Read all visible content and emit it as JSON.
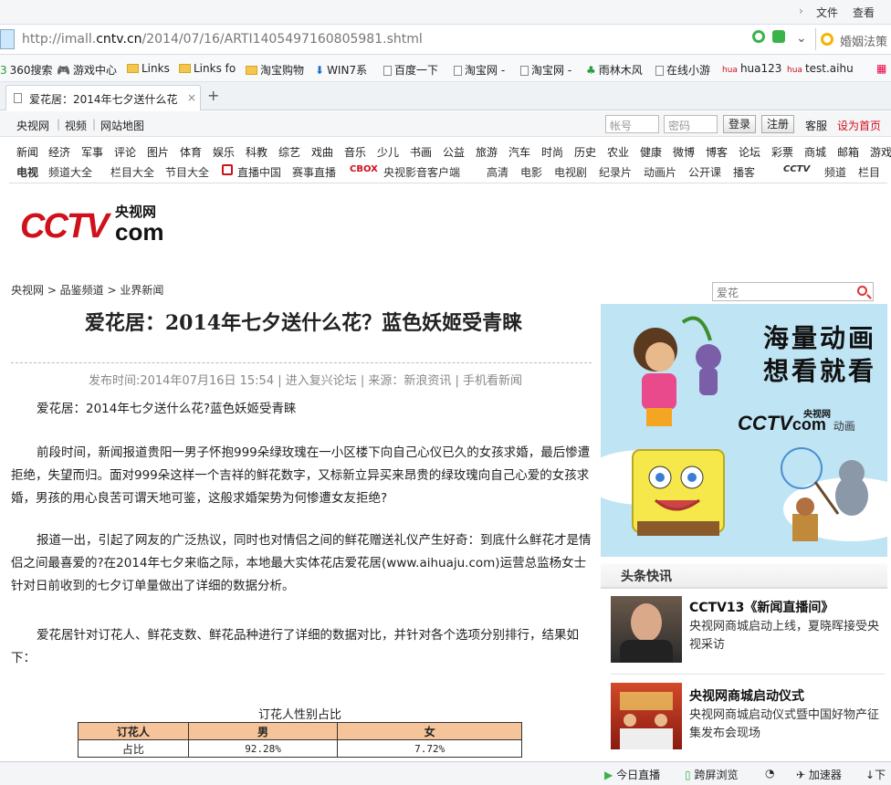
{
  "browser": {
    "menu": {
      "file": "文件",
      "view": "查看"
    },
    "address": {
      "prefix": "http://imall.",
      "domain": "cntv.cn",
      "path": "/2014/07/16/ARTI1405497160805981.shtml"
    },
    "search_hint": "婚姻法策",
    "bookmarks": [
      "360搜索",
      "游戏中心",
      "Links",
      "Links fo",
      "淘宝购物",
      "WIN7系",
      "百度一下",
      "淘宝网 -",
      "淘宝网 -",
      "雨林木风",
      "在线小游",
      "hua123",
      "test.aihu"
    ],
    "tab_title": "爱花居：2014年七夕送什么花",
    "new_tab": "+"
  },
  "site": {
    "top_links": [
      "央视网",
      "视频",
      "网站地图"
    ],
    "username_placeholder": "帐号",
    "password_placeholder": "密码",
    "login": "登录",
    "register": "注册",
    "service": "客服",
    "set_home": "设为首页",
    "nav1": [
      "新闻",
      "经济",
      "军事",
      "评论",
      "图片",
      "体育",
      "娱乐",
      "科教",
      "综艺",
      "戏曲",
      "音乐",
      "少儿",
      "书画",
      "公益",
      "旅游",
      "汽车",
      "时尚",
      "历史",
      "农业",
      "健康",
      "微博",
      "博客",
      "论坛",
      "彩票",
      "商城",
      "邮箱",
      "游戏"
    ],
    "nav2": [
      "电视",
      "频道大全",
      "栏目大全",
      "节目大全",
      "直播中国",
      "赛事直播",
      "央视影音客户端",
      "高清",
      "电影",
      "电视剧",
      "纪录片",
      "动画片",
      "公开课",
      "播客",
      "频道",
      "栏目"
    ],
    "nav2_box": "CBOX",
    "nav2_cctv": "CCTV",
    "logo_text": "CCTV",
    "logo_com": "com",
    "logo_cn": "央视网"
  },
  "article": {
    "breadcrumb": "央视网 > 品鉴频道 > 业界新闻",
    "title": "爱花居：2014年七夕送什么花？蓝色妖姬受青睐",
    "meta": "发布时间:2014年07月16日  15:54 | 进入复兴论坛 | 来源：新浪资讯 | 手机看新闻",
    "paragraphs": [
      "爱花居：2014年七夕送什么花?蓝色妖姬受青睐",
      "前段时间，新闻报道贵阳一男子怀抱999朵绿玫瑰在一小区楼下向自己心仪已久的女孩求婚，最后惨遭拒绝，失望而归。面对999朵这样一个吉祥的鲜花数字，又标新立异买来昂贵的绿玫瑰向自己心爱的女孩求婚，男孩的用心良苦可谓天地可鉴，这般求婚架势为何惨遭女友拒绝?",
      "报道一出，引起了网友的广泛热议，同时也对情侣之间的鲜花赠送礼仪产生好奇：到底什么鲜花才是情侣之间最喜爱的?在2014年七夕来临之际，本地最大实体花店爱花居(www.aihuaju.com)运营总监杨女士针对日前收到的七夕订单量做出了详细的数据分析。",
      "爱花居针对订花人、鲜花支数、鲜花品种进行了详细的数据对比，并针对各个选项分别排行，结果如下："
    ],
    "table": {
      "caption": "订花人性别占比",
      "headers": [
        "订花人",
        "男",
        "女"
      ],
      "row": [
        "占比",
        "92.28%",
        "7.72%"
      ]
    }
  },
  "sidebar": {
    "search_value": "爱花",
    "banner_line1": "海量动画",
    "banner_line2": "想看就看",
    "banner_logo": "CCTV",
    "banner_com": "com",
    "banner_cn": "央视网",
    "banner_sub": "动画",
    "section_title": "头条快讯",
    "news": [
      {
        "title": "CCTV13《新闻直播间》",
        "desc": "央视网商城启动上线，夏晓晖接受央视采访"
      },
      {
        "title": "央视网商城启动仪式",
        "desc": "央视网商城启动仪式暨中国好物产征集发布会现场"
      }
    ]
  },
  "statusbar": [
    "今日直播",
    "跨屏浏览",
    "加速器",
    "下"
  ],
  "colors": {
    "brand_red": "#d0101b",
    "table_header": "#f6c49a",
    "banner_bg": "#bfe4f4"
  }
}
